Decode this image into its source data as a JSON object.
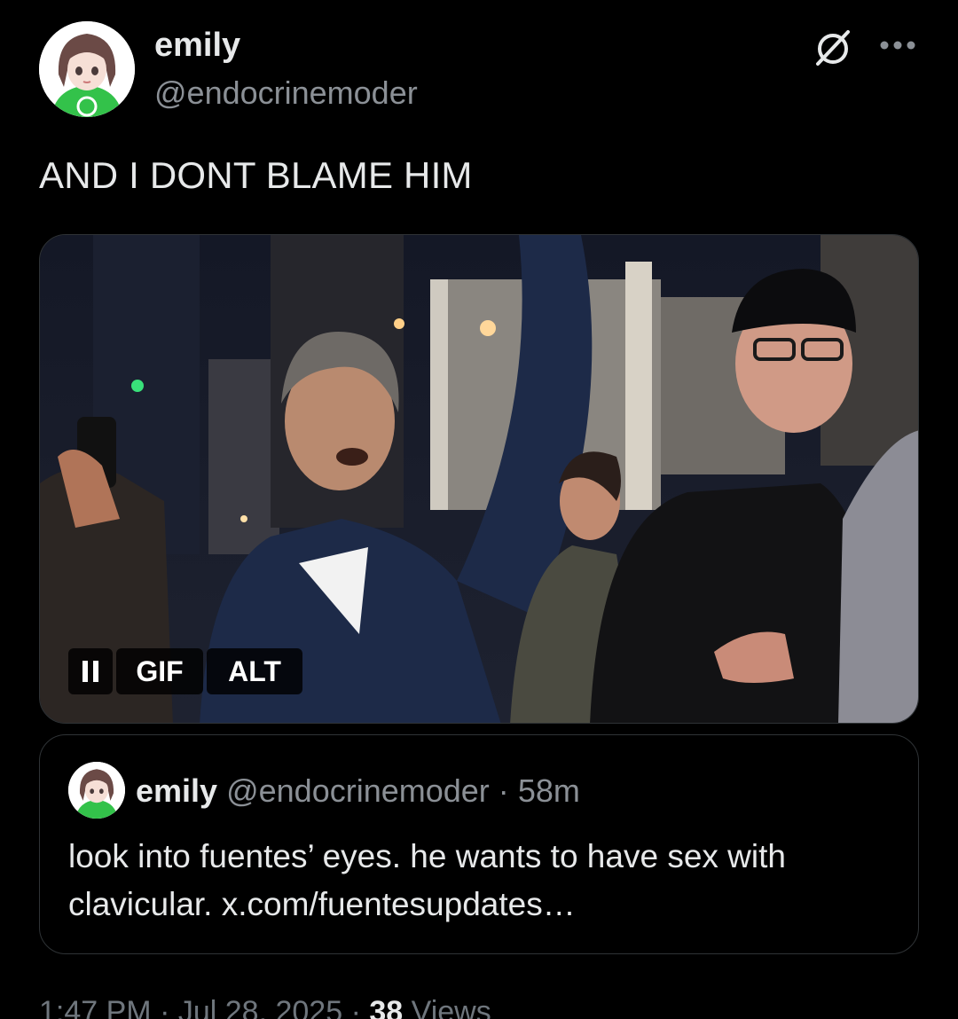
{
  "author": {
    "display_name": "emily",
    "handle": "@endocrinemoder",
    "avatar_icon": "anime-girl-avatar"
  },
  "header_actions": {
    "grok_icon": "grok-slash-circle-icon",
    "more_icon": "more-horizontal-icon"
  },
  "tweet": {
    "text": "AND I DONT BLAME HIM"
  },
  "media": {
    "type": "gif",
    "pause_icon": "pause-icon",
    "gif_label": "GIF",
    "alt_label": "ALT"
  },
  "quote": {
    "display_name": "emily",
    "handle": "@endocrinemoder",
    "separator": "·",
    "time": "58m",
    "text": "look into fuentes’ eyes. he wants to have sex with clavicular. x.com/fuentesupdates…"
  },
  "footer": {
    "time": "1:47 PM",
    "sep1": "·",
    "date": "Jul 28, 2025",
    "sep2": "·",
    "views_count": "38",
    "views_label": "Views"
  },
  "colors": {
    "background": "#000000",
    "primary_text": "#e7e9ea",
    "secondary_text": "#8b9096",
    "border": "#2f3336",
    "avatar_green": "#2ecc40"
  }
}
